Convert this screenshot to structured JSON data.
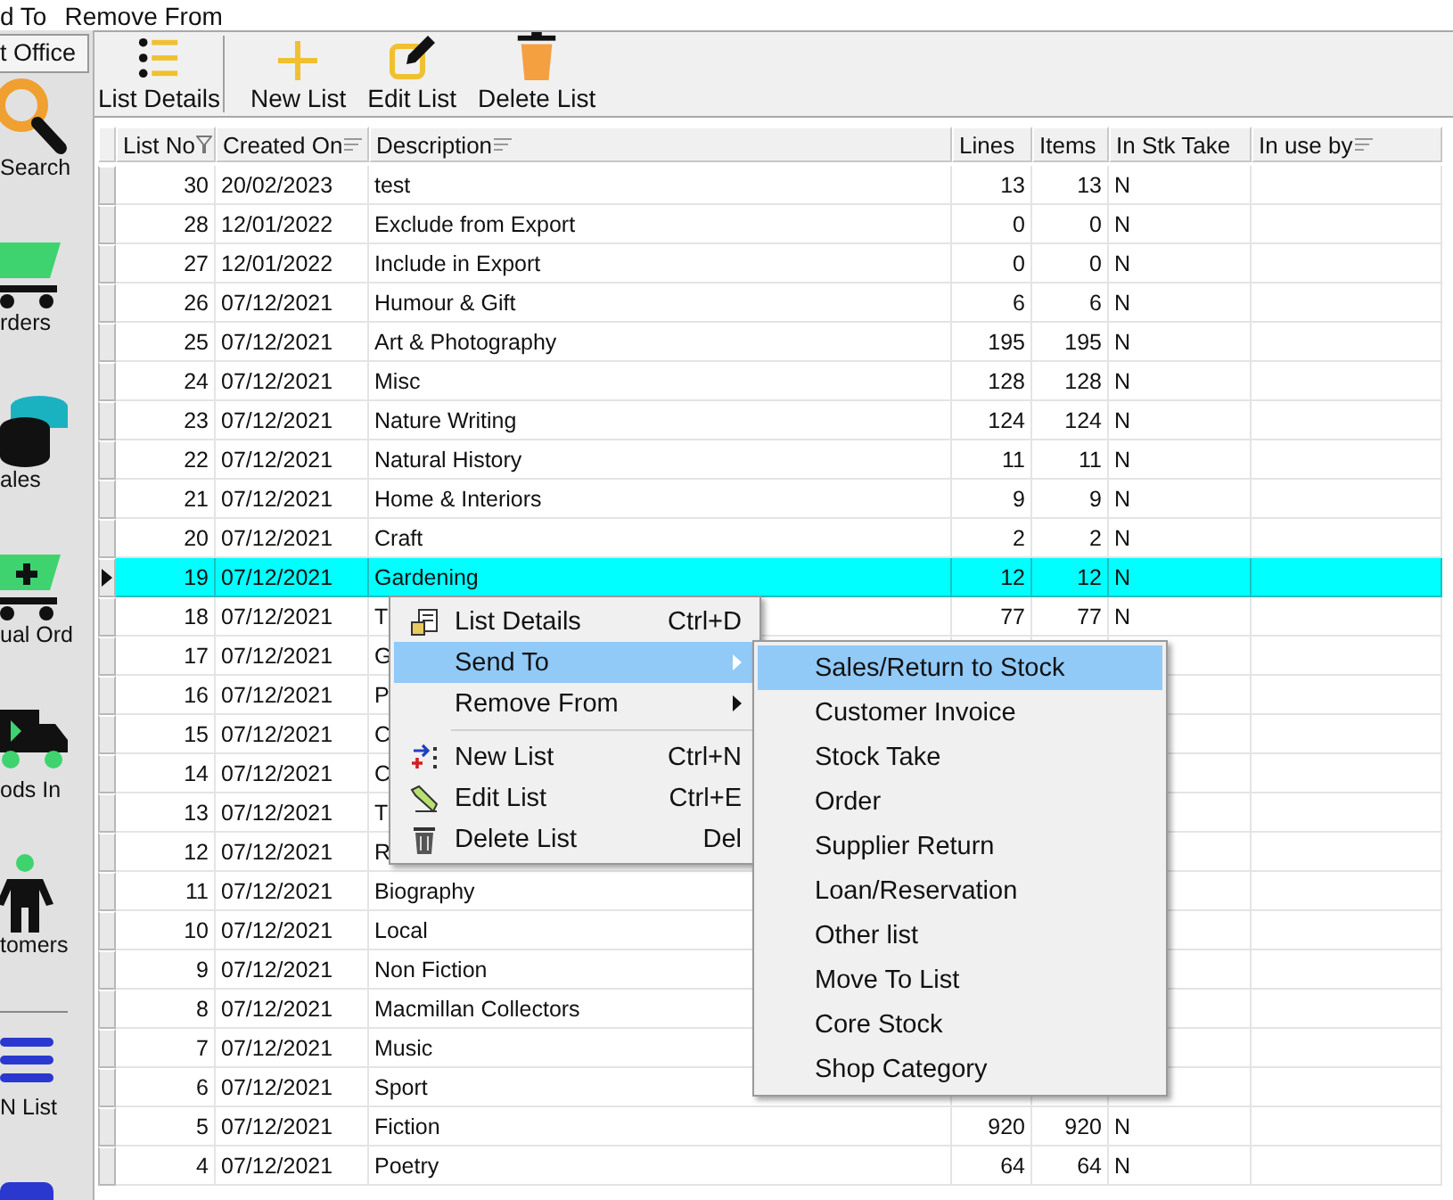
{
  "menu_bar": {
    "items": [
      "d To",
      "Remove From"
    ]
  },
  "sidebar": {
    "tab": "t Office",
    "items": [
      "Search",
      "rders",
      "ales",
      "ual Ord",
      "ods In",
      "tomers",
      "N List"
    ]
  },
  "toolbar": {
    "buttons": [
      "List Details",
      "New List",
      "Edit List",
      "Delete List"
    ]
  },
  "table": {
    "columns": [
      "List No",
      "Created On",
      "Description",
      "Lines",
      "Items",
      "In Stk Take",
      "In use by"
    ],
    "rows": [
      {
        "list_no": "30",
        "created_on": "20/02/2023",
        "description": "test",
        "lines": "13",
        "items": "13",
        "in_stk_take": "N",
        "selected": false
      },
      {
        "list_no": "28",
        "created_on": "12/01/2022",
        "description": "Exclude from Export",
        "lines": "0",
        "items": "0",
        "in_stk_take": "N",
        "selected": false
      },
      {
        "list_no": "27",
        "created_on": "12/01/2022",
        "description": "Include in Export",
        "lines": "0",
        "items": "0",
        "in_stk_take": "N",
        "selected": false
      },
      {
        "list_no": "26",
        "created_on": "07/12/2021",
        "description": "Humour & Gift",
        "lines": "6",
        "items": "6",
        "in_stk_take": "N",
        "selected": false
      },
      {
        "list_no": "25",
        "created_on": "07/12/2021",
        "description": "Art & Photography",
        "lines": "195",
        "items": "195",
        "in_stk_take": "N",
        "selected": false
      },
      {
        "list_no": "24",
        "created_on": "07/12/2021",
        "description": "Misc",
        "lines": "128",
        "items": "128",
        "in_stk_take": "N",
        "selected": false
      },
      {
        "list_no": "23",
        "created_on": "07/12/2021",
        "description": "Nature Writing",
        "lines": "124",
        "items": "124",
        "in_stk_take": "N",
        "selected": false
      },
      {
        "list_no": "22",
        "created_on": "07/12/2021",
        "description": "Natural History",
        "lines": "11",
        "items": "11",
        "in_stk_take": "N",
        "selected": false
      },
      {
        "list_no": "21",
        "created_on": "07/12/2021",
        "description": "Home & Interiors",
        "lines": "9",
        "items": "9",
        "in_stk_take": "N",
        "selected": false
      },
      {
        "list_no": "20",
        "created_on": "07/12/2021",
        "description": "Craft",
        "lines": "2",
        "items": "2",
        "in_stk_take": "N",
        "selected": false
      },
      {
        "list_no": "19",
        "created_on": "07/12/2021",
        "description": "Gardening",
        "lines": "12",
        "items": "12",
        "in_stk_take": "N",
        "selected": true
      },
      {
        "list_no": "18",
        "created_on": "07/12/2021",
        "description": "T",
        "lines": "77",
        "items": "77",
        "in_stk_take": "N",
        "selected": false
      },
      {
        "list_no": "17",
        "created_on": "07/12/2021",
        "description": "G",
        "selected": false
      },
      {
        "list_no": "16",
        "created_on": "07/12/2021",
        "description": "P",
        "selected": false
      },
      {
        "list_no": "15",
        "created_on": "07/12/2021",
        "description": "C",
        "selected": false
      },
      {
        "list_no": "14",
        "created_on": "07/12/2021",
        "description": "C",
        "selected": false
      },
      {
        "list_no": "13",
        "created_on": "07/12/2021",
        "description": "T",
        "selected": false
      },
      {
        "list_no": "12",
        "created_on": "07/12/2021",
        "description": "R",
        "selected": false
      },
      {
        "list_no": "11",
        "created_on": "07/12/2021",
        "description": "Biography",
        "selected": false
      },
      {
        "list_no": "10",
        "created_on": "07/12/2021",
        "description": "Local",
        "selected": false
      },
      {
        "list_no": "9",
        "created_on": "07/12/2021",
        "description": "Non Fiction",
        "selected": false
      },
      {
        "list_no": "8",
        "created_on": "07/12/2021",
        "description": "Macmillan Collectors",
        "selected": false
      },
      {
        "list_no": "7",
        "created_on": "07/12/2021",
        "description": "Music",
        "selected": false
      },
      {
        "list_no": "6",
        "created_on": "07/12/2021",
        "description": "Sport",
        "selected": false
      },
      {
        "list_no": "5",
        "created_on": "07/12/2021",
        "description": "Fiction",
        "lines": "920",
        "items": "920",
        "in_stk_take": "N",
        "selected": false
      },
      {
        "list_no": "4",
        "created_on": "07/12/2021",
        "description": "Poetry",
        "lines": "64",
        "items": "64",
        "in_stk_take": "N",
        "selected": false
      }
    ]
  },
  "context_menu": {
    "items": [
      {
        "kind": "command",
        "label": "List Details",
        "shortcut": "Ctrl+D",
        "selected": false
      },
      {
        "kind": "submenu",
        "label": "Send To",
        "selected": true
      },
      {
        "kind": "submenu",
        "label": "Remove From",
        "selected": false
      },
      {
        "kind": "separator"
      },
      {
        "kind": "command",
        "label": "New List",
        "shortcut": "Ctrl+N",
        "selected": false
      },
      {
        "kind": "command",
        "label": "Edit List",
        "shortcut": "Ctrl+E",
        "selected": false
      },
      {
        "kind": "command",
        "label": "Delete List",
        "shortcut": "Del",
        "selected": false
      }
    ]
  },
  "submenu": {
    "items": [
      {
        "label": "Sales/Return to Stock",
        "selected": true
      },
      {
        "label": "Customer Invoice",
        "selected": false
      },
      {
        "label": "Stock Take",
        "selected": false
      },
      {
        "label": "Order",
        "selected": false
      },
      {
        "label": "Supplier Return",
        "selected": false
      },
      {
        "label": "Loan/Reservation",
        "selected": false
      },
      {
        "label": "Other list",
        "selected": false
      },
      {
        "label": "Move To List",
        "selected": false
      },
      {
        "label": "Core Stock",
        "selected": false
      },
      {
        "label": "Shop Category",
        "selected": false
      }
    ]
  }
}
